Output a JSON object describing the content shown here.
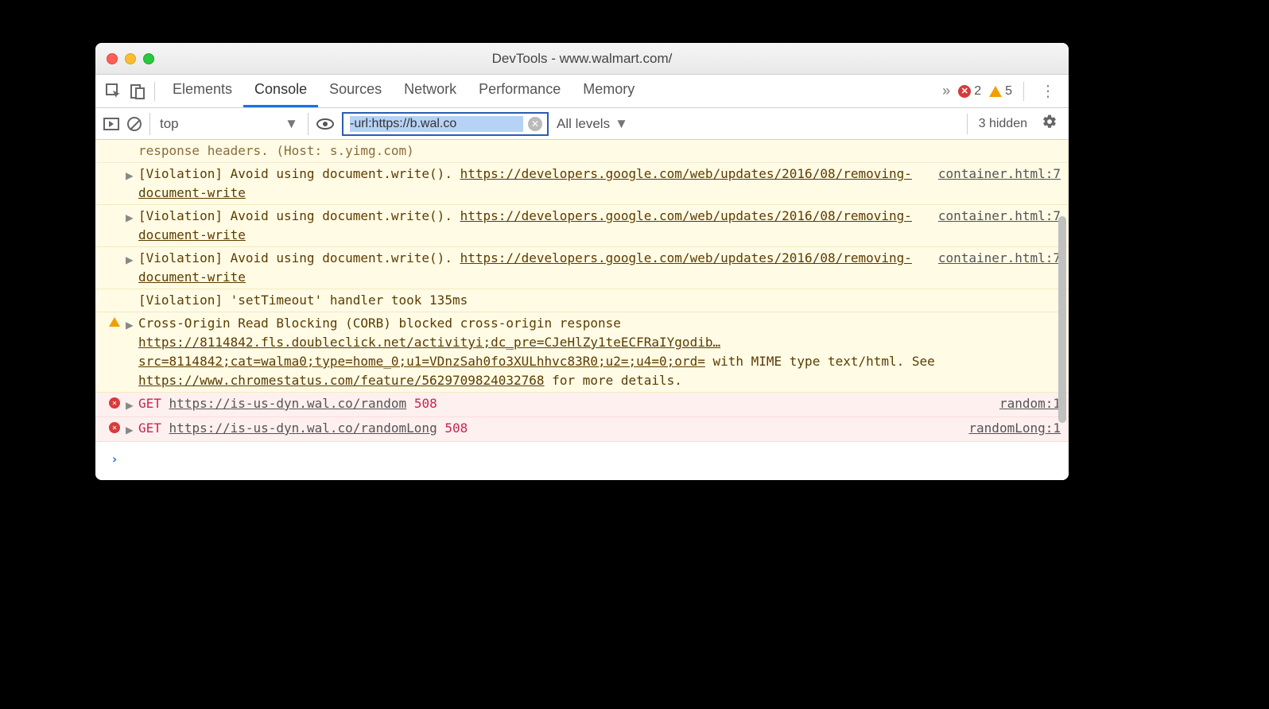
{
  "window": {
    "title": "DevTools - www.walmart.com/"
  },
  "tabs": {
    "items": [
      "Elements",
      "Console",
      "Sources",
      "Network",
      "Performance",
      "Memory"
    ],
    "active": "Console",
    "error_count": "2",
    "warn_count": "5"
  },
  "toolbar": {
    "context": "top",
    "filter_value": "-url:https://b.wal.co",
    "levels_label": "All levels",
    "hidden_label": "3 hidden"
  },
  "rows": {
    "clipped": "response headers. (Host: s.yimg.com)",
    "viol1_a": "[Violation] Avoid using document.write(). ",
    "viol1_link": "https://developers.google.com/web/updates/2016/08/removing-document-write",
    "viol1_src": "container.html:7",
    "viol_timeout": "[Violation] 'setTimeout' handler took 135ms",
    "corb_a": "Cross-Origin Read Blocking (CORB) blocked cross-origin response ",
    "corb_link1": "https://8114842.fls.doubleclick.net/activityi;dc_pre=CJeHlZy1teECFRaIYgodib…src=8114842;cat=walma0;type=home_0;u1=VDnzSah0fo3XULhhvc83R0;u2=;u4=0;ord=",
    "corb_b": " with MIME type text/html. See ",
    "corb_link2": "https://www.chromestatus.com/feature/5629709824032768",
    "corb_c": " for more details.",
    "err1_method": "GET",
    "err1_url": "https://is-us-dyn.wal.co/random",
    "err1_status": "508",
    "err1_src": "random:1",
    "err2_method": "GET",
    "err2_url": "https://is-us-dyn.wal.co/randomLong",
    "err2_status": "508",
    "err2_src": "randomLong:1"
  }
}
